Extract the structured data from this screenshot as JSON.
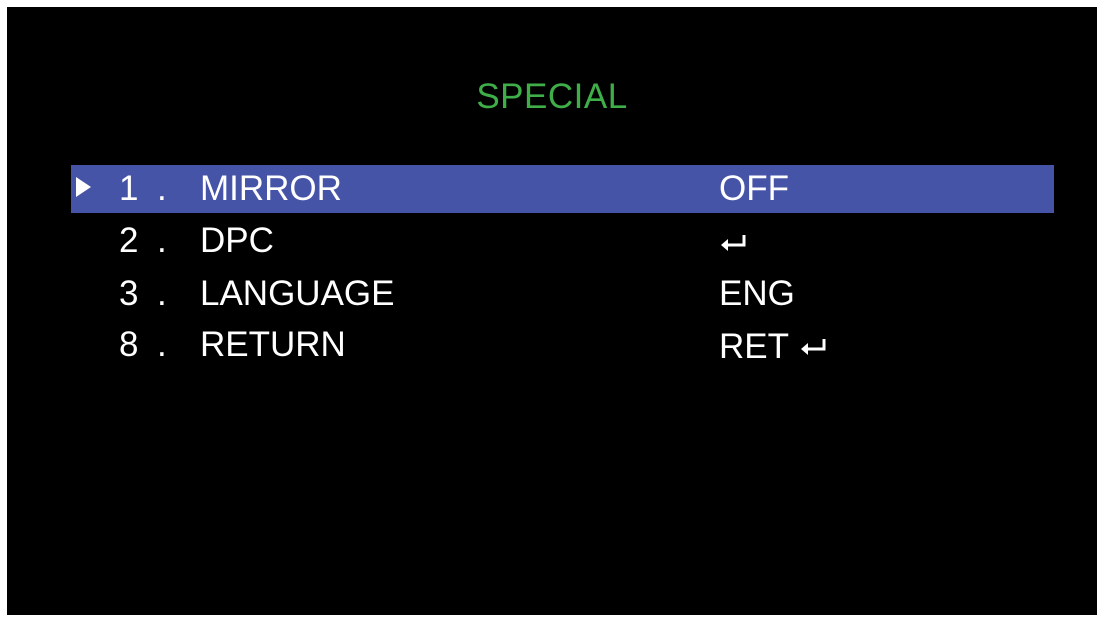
{
  "menu": {
    "title": "SPECIAL",
    "items": [
      {
        "number": "1",
        "separator": ".",
        "label": "MIRROR",
        "value": "OFF",
        "selected": true
      },
      {
        "number": "2",
        "separator": ".",
        "label": "DPC",
        "value": "",
        "icon": "enter-arrow-icon",
        "selected": false
      },
      {
        "number": "3",
        "separator": ".",
        "label": "LANGUAGE",
        "value": "ENG",
        "selected": false
      },
      {
        "number": "8",
        "separator": ".",
        "label": "RETURN",
        "value": "RET",
        "icon": "enter-arrow-icon",
        "selected": false
      }
    ]
  },
  "colors": {
    "background": "#000000",
    "title": "#3fae49",
    "text": "#ffffff",
    "selection": "#4654a8",
    "border": "#ffffff"
  },
  "icons": {
    "cursor": "triangle-right-icon",
    "enter": "enter-arrow-icon"
  }
}
